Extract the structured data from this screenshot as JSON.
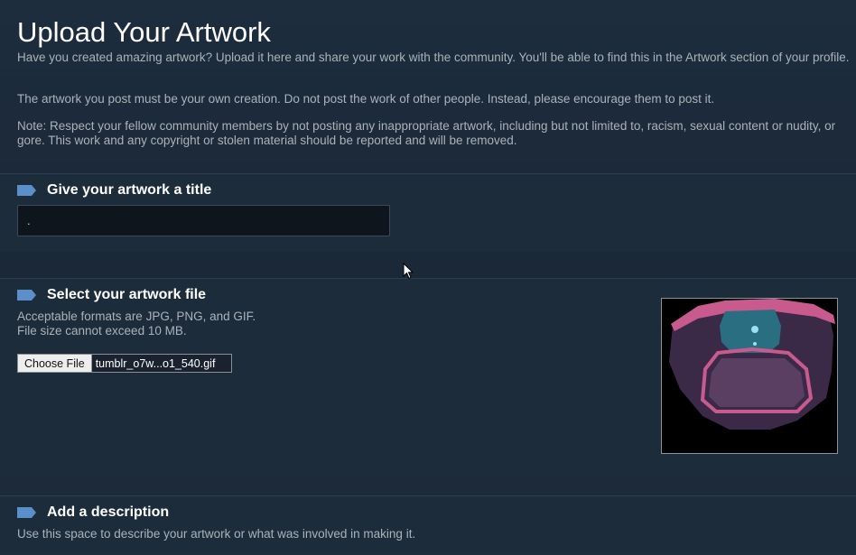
{
  "header": {
    "title": "Upload Your Artwork",
    "intro_1": "Have you created amazing artwork? Upload it here and share your work with the community. You'll be able to find this in the Artwork section of your profile.",
    "intro_2": "The artwork you post must be your own creation. Do not post the work of other people. Instead, please encourage them to post it.",
    "intro_3": "Note: Respect your fellow community members by not posting any inappropriate artwork, including but not limited to, racism, sexual content or nudity, or gore. This work and any copyright or stolen material should be reported and will be removed."
  },
  "title_section": {
    "heading": "Give your artwork a title",
    "input_value": "."
  },
  "file_section": {
    "heading": "Select your artwork file",
    "formats_line1": "Acceptable formats are JPG, PNG, and GIF.",
    "formats_line2": "File size cannot exceed 10 MB.",
    "choose_button": "Choose File",
    "file_name": "tumblr_o7w...o1_540.gif"
  },
  "description_section": {
    "heading": "Add a description",
    "hint": "Use this space to describe your artwork or what was involved in making it."
  },
  "colors": {
    "accent_arrow": "#5a8fc9",
    "background": "#1b2838"
  }
}
